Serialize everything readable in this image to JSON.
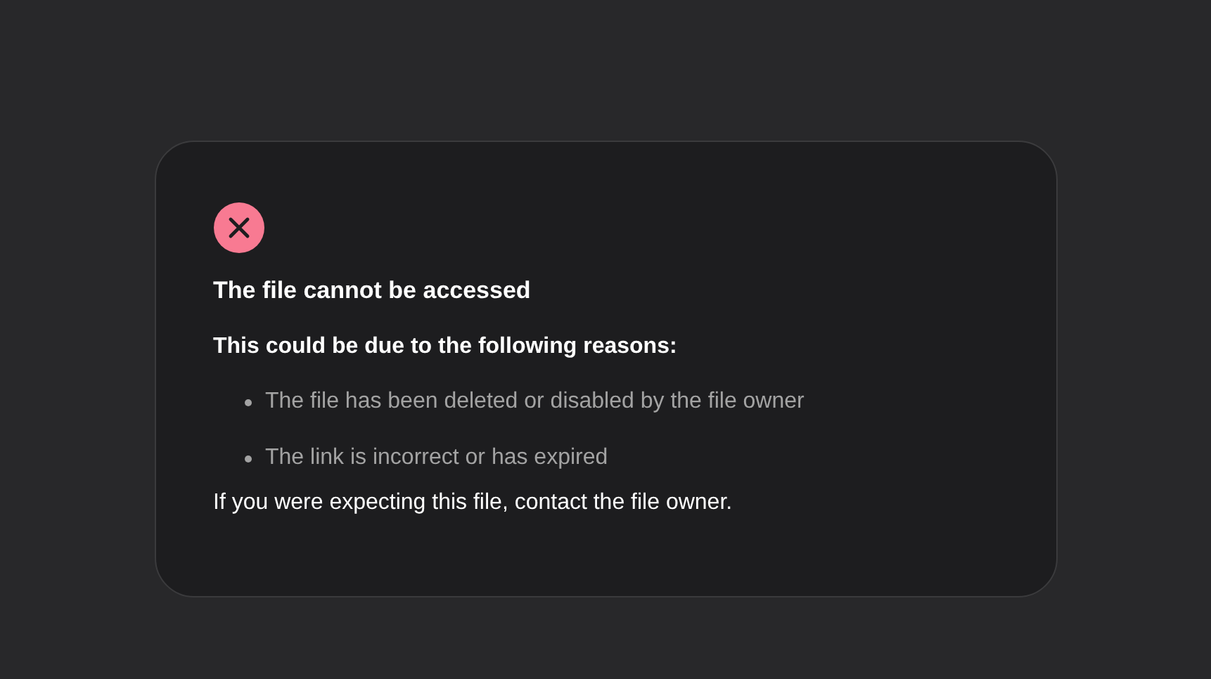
{
  "error_card": {
    "title": "The file cannot be accessed",
    "intro": "This could be due to the following reasons:",
    "reasons": [
      "The file has been deleted or disabled by the file owner",
      "The link is incorrect or has expired"
    ],
    "footer": "If you were expecting this file, contact the file owner."
  }
}
